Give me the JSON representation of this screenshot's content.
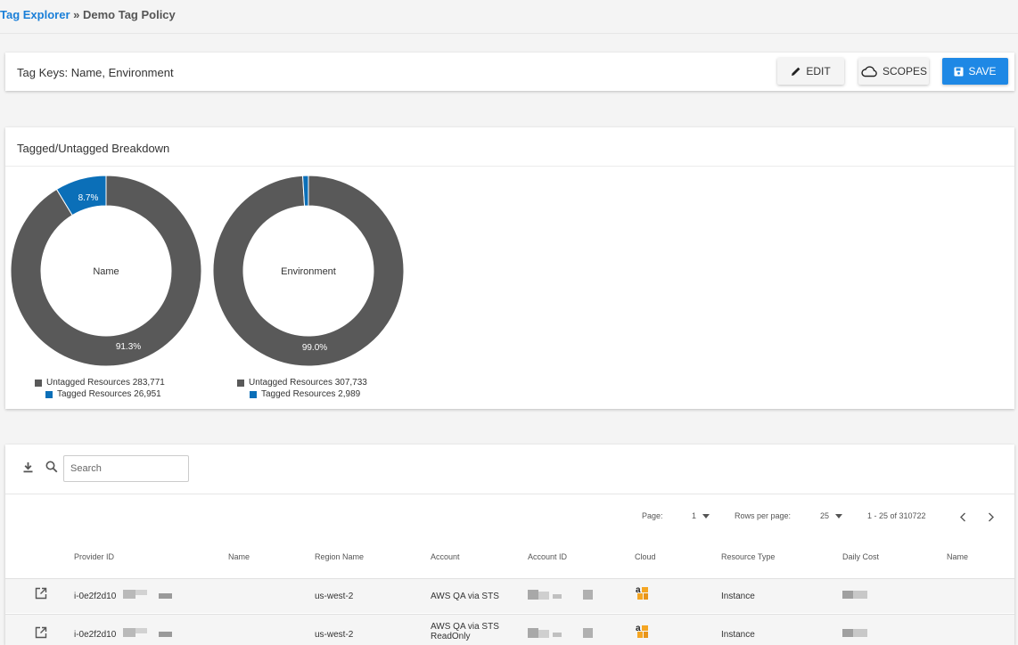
{
  "breadcrumb": {
    "link": "Tag Explorer",
    "separator": " » ",
    "current": "Demo Tag Policy"
  },
  "keys_card": {
    "title": "Tag Keys: Name, Environment"
  },
  "actions": {
    "edit": "EDIT",
    "scopes": "SCOPES",
    "save": "SAVE"
  },
  "colors": {
    "accent": "#1e88e5",
    "link": "#1a7fd8",
    "untagged": "#595959",
    "tagged": "#0b6fb8"
  },
  "breakdown": {
    "title": "Tagged/Untagged Breakdown",
    "charts": [
      {
        "center": "Name",
        "tagged_pct_label": "8.7%",
        "untagged_pct_label": "91.3%",
        "untagged_label": "Untagged Resources 283,771",
        "tagged_label": "Tagged Resources 26,951"
      },
      {
        "center": "Environment",
        "tagged_pct_label": "",
        "untagged_pct_label": "99.0%",
        "untagged_label": "Untagged Resources 307,733",
        "tagged_label": "Tagged Resources 2,989"
      }
    ]
  },
  "chart_data": [
    {
      "type": "pie",
      "title": "Name",
      "categories": [
        "Untagged Resources",
        "Tagged Resources"
      ],
      "values": [
        283771,
        26951
      ],
      "percent_labels": [
        "91.3%",
        "8.7%"
      ]
    },
    {
      "type": "pie",
      "title": "Environment",
      "categories": [
        "Untagged Resources",
        "Tagged Resources"
      ],
      "values": [
        307733,
        2989
      ],
      "percent_labels": [
        "99.0%",
        ""
      ]
    }
  ],
  "table": {
    "search_placeholder": "Search",
    "pager": {
      "page_label": "Page:",
      "page_value": "1",
      "rows_label": "Rows per page:",
      "rows_value": "25",
      "range": "1 - 25 of 310722"
    },
    "columns": [
      "Provider ID",
      "Name",
      "Region Name",
      "Account",
      "Account ID",
      "Cloud",
      "Resource Type",
      "Daily Cost",
      "Name"
    ],
    "rows": [
      {
        "provider_id": "i-0e2f2d10",
        "region": "us-west-2",
        "account_line1": "AWS QA via STS",
        "account_line2": "",
        "resource_type": "Instance"
      },
      {
        "provider_id": "i-0e2f2d10",
        "region": "us-west-2",
        "account_line1": "AWS QA via STS",
        "account_line2": "ReadOnly",
        "resource_type": "Instance"
      }
    ]
  }
}
